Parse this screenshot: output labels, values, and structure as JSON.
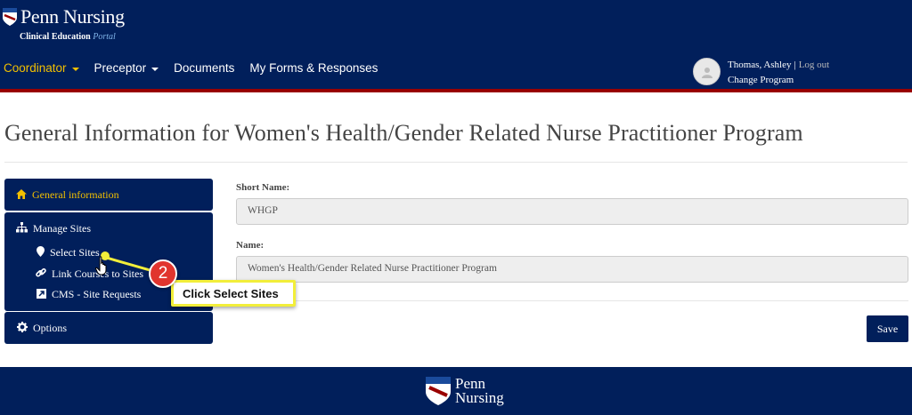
{
  "header": {
    "brand": "Penn Nursing",
    "subtitle_main": "Clinical Education",
    "subtitle_portal": "Portal",
    "nav": [
      {
        "label": "Coordinator",
        "dropdown": true,
        "active": true
      },
      {
        "label": "Preceptor",
        "dropdown": true,
        "active": false
      },
      {
        "label": "Documents",
        "dropdown": false,
        "active": false
      },
      {
        "label": "My Forms & Responses",
        "dropdown": false,
        "active": false
      }
    ],
    "user": {
      "name": "Thomas, Ashley",
      "separator": "|",
      "logout": "Log out",
      "change_program": "Change Program"
    }
  },
  "page": {
    "title": "General Information for Women's Health/Gender Related Nurse Practitioner Program"
  },
  "sidebar": {
    "general": {
      "label": "General information",
      "icon": "home-icon"
    },
    "manage_sites": {
      "label": "Manage Sites",
      "icon": "sitemap-icon",
      "items": [
        {
          "label": "Select Sites",
          "icon": "map-marker-icon"
        },
        {
          "label": "Link Courses to Sites",
          "icon": "link-icon"
        },
        {
          "label": "CMS - Site Requests",
          "icon": "external-link-icon"
        }
      ]
    },
    "options": {
      "label": "Options",
      "icon": "gear-icon"
    }
  },
  "form": {
    "short_name_label": "Short Name:",
    "short_name_value": "WHGP",
    "name_label": "Name:",
    "name_value": "Women's Health/Gender Related Nurse Practitioner Program",
    "save_label": "Save"
  },
  "callout": {
    "step": "2",
    "text": "Click Select Sites"
  },
  "footer": {
    "line1": "Penn",
    "line2": "Nursing"
  },
  "colors": {
    "navy": "#011F5B",
    "accent_red": "#990000",
    "gold": "#F2C000",
    "callout_yellow": "#F2EE3A",
    "badge_red": "#E1352E"
  }
}
